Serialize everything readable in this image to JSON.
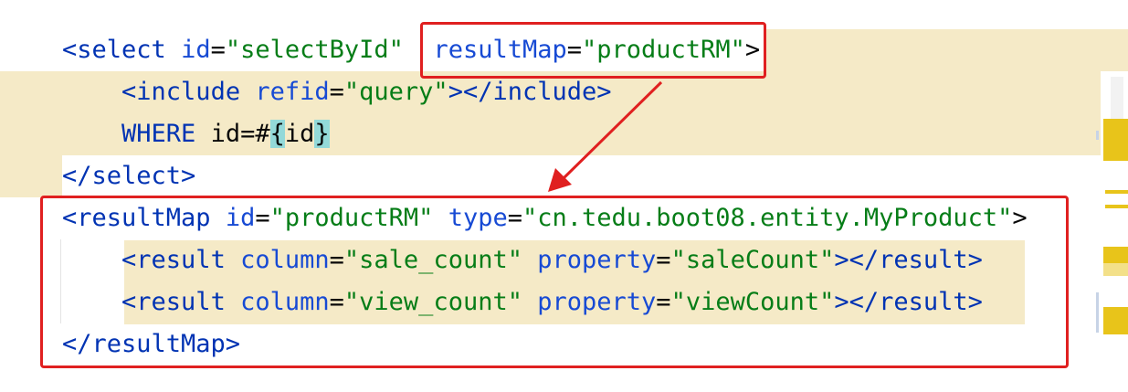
{
  "code": {
    "line1": {
      "open": "<select",
      "id_attr": "id",
      "eq": "=",
      "id_val": "\"selectById\"",
      "rm_attr": "resultMap",
      "rm_val": "\"productRM\"",
      "close": ">"
    },
    "line2": {
      "open": "<include",
      "attr": "refid",
      "eq": "=",
      "val": "\"query\"",
      "close": "></include>"
    },
    "line3": {
      "kw": "WHERE",
      "text": "id=",
      "hash": "#",
      "brace_open": "{",
      "param": "id",
      "brace_close": "}"
    },
    "line4": {
      "text": "</select>"
    },
    "line5": {
      "open": "<resultMap",
      "id_attr": "id",
      "eq": "=",
      "id_val": "\"productRM\"",
      "type_attr": "type",
      "type_val": "\"cn.tedu.boot08.entity.MyProduct\"",
      "close": ">"
    },
    "line6": {
      "open": "<result",
      "col_attr": "column",
      "eq": "=",
      "col_val": "\"sale_count\"",
      "prop_attr": "property",
      "prop_val": "\"saleCount\"",
      "close": "></result>"
    },
    "line7": {
      "open": "<result",
      "col_attr": "column",
      "eq": "=",
      "col_val": "\"view_count\"",
      "prop_attr": "property",
      "prop_val": "\"viewCount\"",
      "close": "></result>"
    },
    "line8": {
      "text": "</resultMap>"
    }
  },
  "colors": {
    "tag": "#0033b3",
    "string": "#067d17",
    "highlight": "#f5eac7",
    "callout": "#e02020",
    "brace_match": "#93d9d9"
  }
}
